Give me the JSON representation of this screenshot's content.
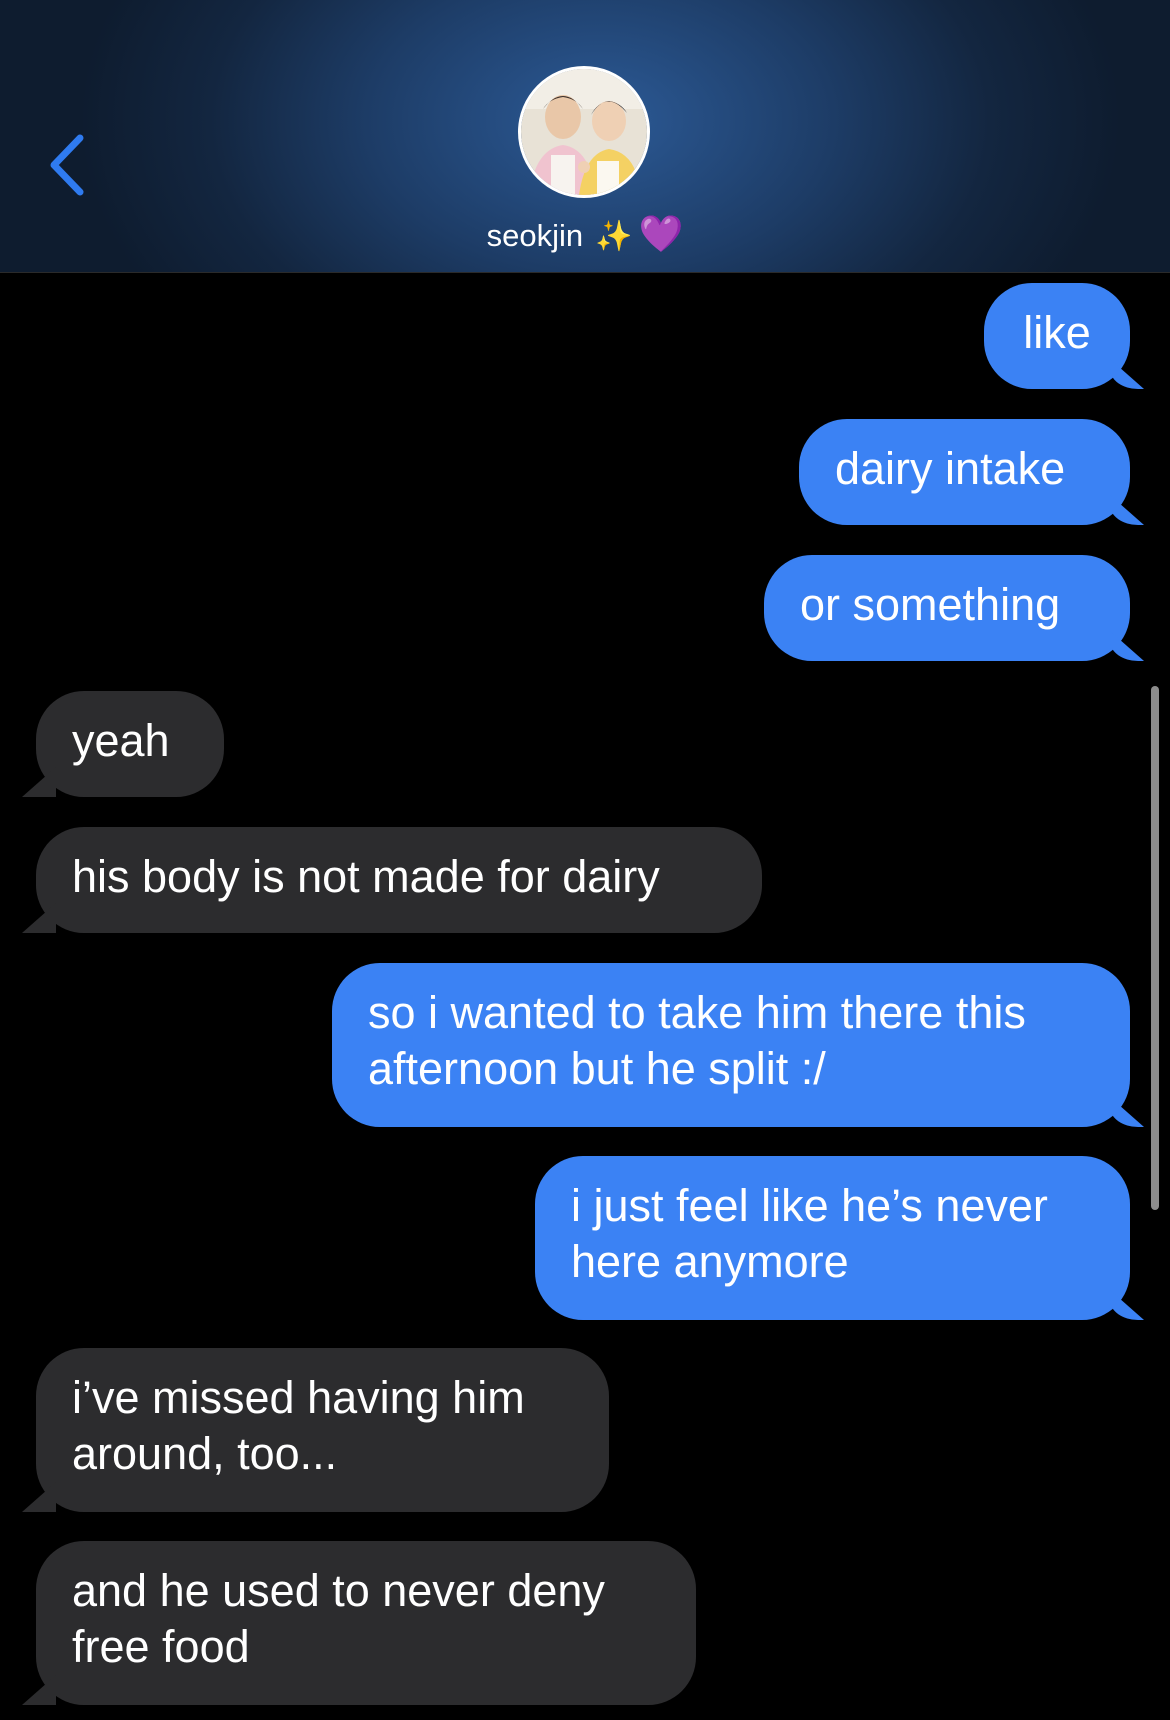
{
  "header": {
    "contact_name": "seokjin",
    "sparkle_emoji": "✨",
    "heart_emoji": "💜",
    "back_icon": "chevron-left-icon",
    "accent": "#2f7bf0"
  },
  "messages": [
    {
      "from": "me",
      "text": "like"
    },
    {
      "from": "me",
      "text": "dairy intake"
    },
    {
      "from": "me",
      "text": "or something"
    },
    {
      "from": "them",
      "text": "yeah"
    },
    {
      "from": "them",
      "text": "his body is not made for dairy"
    },
    {
      "from": "me",
      "lines": [
        "so i wanted to take him there this",
        "afternoon but he split :/"
      ]
    },
    {
      "from": "me",
      "lines": [
        "i just feel like he’s never",
        "here anymore"
      ]
    },
    {
      "from": "them",
      "lines": [
        "i’ve missed having him",
        "around, too..."
      ]
    },
    {
      "from": "them",
      "lines": [
        "and he used to never deny",
        "free food"
      ]
    }
  ],
  "colors": {
    "sent_bubble": "#3b82f4",
    "received_bubble": "#2c2c2e",
    "background": "#000000"
  }
}
